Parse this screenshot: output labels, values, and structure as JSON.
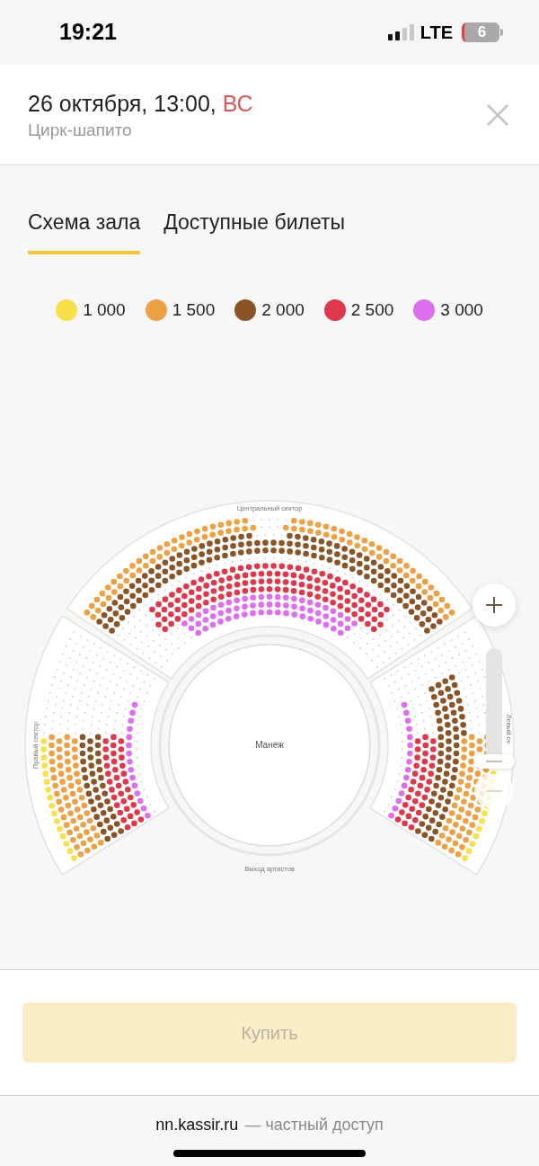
{
  "status_bar": {
    "time": "19:21",
    "network": "LTE",
    "battery": "6"
  },
  "header": {
    "date": "26 октября, 13:00, ",
    "weekday": "ВС",
    "venue": "Цирк-шапито"
  },
  "tabs": [
    {
      "label": "Схема зала",
      "selected": true
    },
    {
      "label": "Доступные билеты",
      "selected": false
    }
  ],
  "legend": [
    {
      "label": "1 000",
      "color": "#f7e04a"
    },
    {
      "label": "1 500",
      "color": "#eea044"
    },
    {
      "label": "2 000",
      "color": "#8b5426"
    },
    {
      "label": "2 500",
      "color": "#e0384b"
    },
    {
      "label": "3 000",
      "color": "#de6ef0"
    }
  ],
  "seat_map": {
    "top_label": "Центральный сектор",
    "left_label": "Правый сектор",
    "right_label": "Левый се",
    "center_label": "Манеж",
    "bottom_label": "Выход артистов"
  },
  "buy_button": {
    "label": "Купить",
    "disabled": true
  },
  "footer": {
    "domain": "nn.kassir.ru",
    "note": "— частный доступ"
  }
}
